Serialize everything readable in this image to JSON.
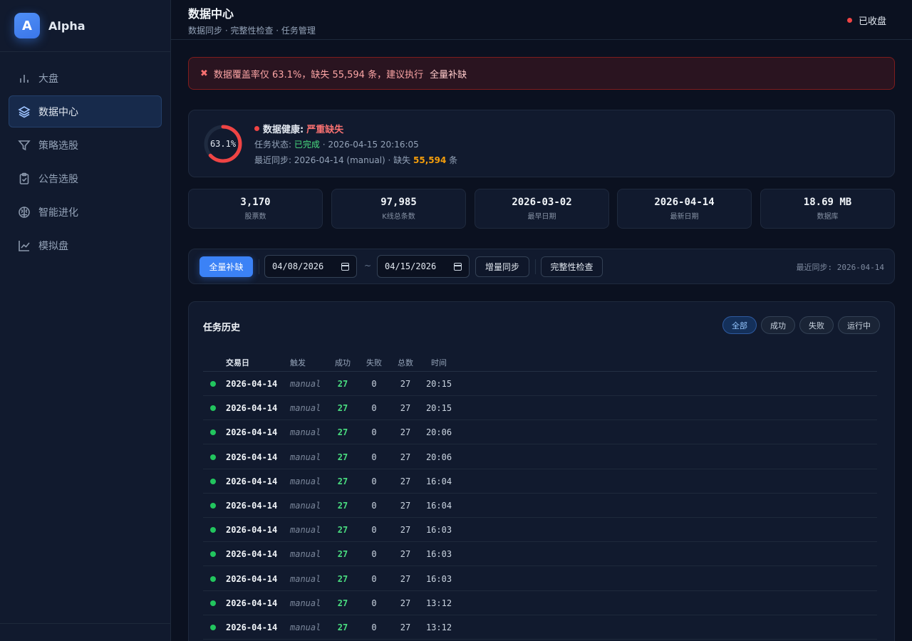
{
  "brand": {
    "logo_letter": "A",
    "name": "Alpha"
  },
  "sidebar": {
    "items": [
      {
        "label": "大盘",
        "icon": "bar-chart-icon"
      },
      {
        "label": "数据中心",
        "icon": "layers-icon",
        "active": true
      },
      {
        "label": "策略选股",
        "icon": "filter-icon"
      },
      {
        "label": "公告选股",
        "icon": "clipboard-icon"
      },
      {
        "label": "智能进化",
        "icon": "brain-icon"
      },
      {
        "label": "模拟盘",
        "icon": "line-chart-icon"
      }
    ]
  },
  "header": {
    "title": "数据中心",
    "subtitle": "数据同步 · 完整性检查 · 任务管理",
    "market_status": "已收盘"
  },
  "alert": {
    "message": "数据覆盖率仅 63.1%，缺失 55,594 条，建议执行",
    "action": "全量补缺"
  },
  "health": {
    "coverage_label": "63.1%",
    "coverage_fraction": 0.631,
    "health_prefix": "数据健康:",
    "health_value": "严重缺失",
    "task_prefix": "任务状态:",
    "task_status": "已完成",
    "task_time": "· 2026-04-15 20:16:05",
    "sync_text": "最近同步: 2026-04-14 (manual) · 缺失",
    "missing_count": "55,594",
    "missing_unit": "条"
  },
  "stats": [
    {
      "value": "3,170",
      "label": "股票数"
    },
    {
      "value": "97,985",
      "label": "K线总条数"
    },
    {
      "value": "2026-03-02",
      "label": "最早日期"
    },
    {
      "value": "2026-04-14",
      "label": "最新日期"
    },
    {
      "value": "18.69 MB",
      "label": "数据库"
    }
  ],
  "toolbar": {
    "fill_all_label": "全量补缺",
    "start_date": "04/08/2026",
    "end_date": "04/15/2026",
    "range_separator": "~",
    "incremental_label": "增量同步",
    "integrity_label": "完整性检查",
    "last_sync": "最近同步: 2026-04-14"
  },
  "history": {
    "title": "任务历史",
    "filters": [
      "全部",
      "成功",
      "失败",
      "运行中"
    ],
    "active_filter": "全部",
    "columns": [
      "交易日",
      "触发",
      "成功",
      "失败",
      "总数",
      "时间"
    ],
    "rows": [
      {
        "date": "2026-04-14",
        "trigger": "manual",
        "success": "27",
        "fail": "0",
        "total": "27",
        "time": "20:15"
      },
      {
        "date": "2026-04-14",
        "trigger": "manual",
        "success": "27",
        "fail": "0",
        "total": "27",
        "time": "20:15"
      },
      {
        "date": "2026-04-14",
        "trigger": "manual",
        "success": "27",
        "fail": "0",
        "total": "27",
        "time": "20:06"
      },
      {
        "date": "2026-04-14",
        "trigger": "manual",
        "success": "27",
        "fail": "0",
        "total": "27",
        "time": "20:06"
      },
      {
        "date": "2026-04-14",
        "trigger": "manual",
        "success": "27",
        "fail": "0",
        "total": "27",
        "time": "16:04"
      },
      {
        "date": "2026-04-14",
        "trigger": "manual",
        "success": "27",
        "fail": "0",
        "total": "27",
        "time": "16:04"
      },
      {
        "date": "2026-04-14",
        "trigger": "manual",
        "success": "27",
        "fail": "0",
        "total": "27",
        "time": "16:03"
      },
      {
        "date": "2026-04-14",
        "trigger": "manual",
        "success": "27",
        "fail": "0",
        "total": "27",
        "time": "16:03"
      },
      {
        "date": "2026-04-14",
        "trigger": "manual",
        "success": "27",
        "fail": "0",
        "total": "27",
        "time": "16:03"
      },
      {
        "date": "2026-04-14",
        "trigger": "manual",
        "success": "27",
        "fail": "0",
        "total": "27",
        "time": "13:12"
      },
      {
        "date": "2026-04-14",
        "trigger": "manual",
        "success": "27",
        "fail": "0",
        "total": "27",
        "time": "13:12"
      }
    ]
  },
  "colors": {
    "accent": "#3b82f6",
    "danger": "#ef4444",
    "success": "#22c55e",
    "warning": "#f59e0b"
  }
}
